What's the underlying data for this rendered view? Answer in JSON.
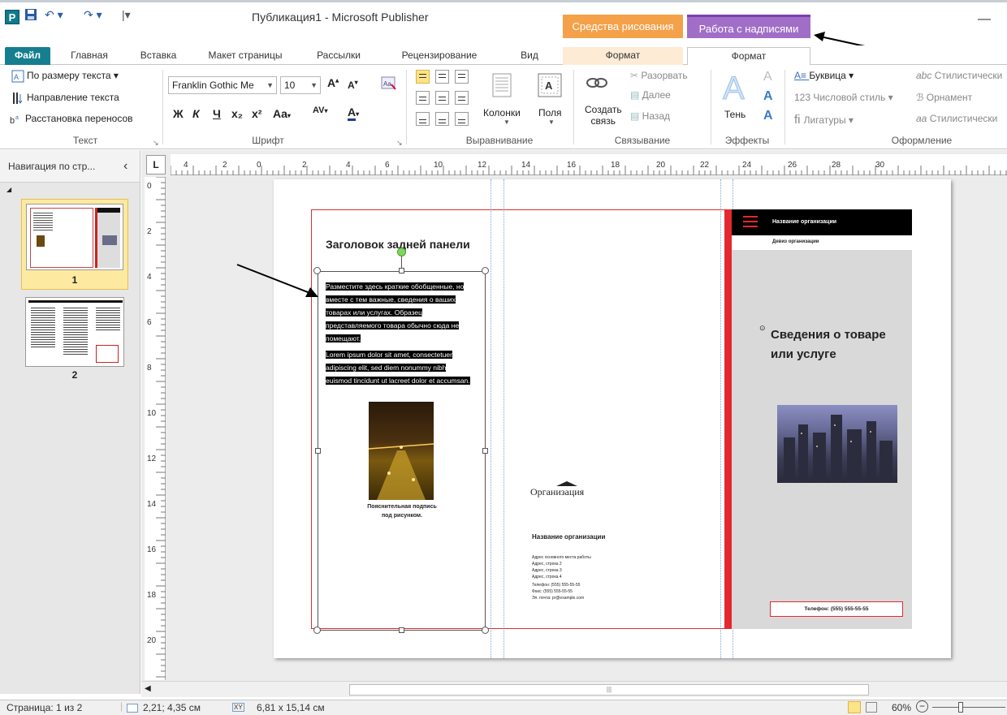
{
  "titlebar": {
    "window_title": "Публикация1 - Microsoft Publisher",
    "ctx_drawing": "Средства рисования",
    "ctx_text": "Работа с надписями",
    "minimize": "—"
  },
  "tabs": {
    "file": "Файл",
    "items": [
      "Главная",
      "Вставка",
      "Макет страницы",
      "Рассылки",
      "Рецензирование",
      "Вид"
    ],
    "ctx_format_draw": "Формат",
    "ctx_format_text": "Формат"
  },
  "ribbon": {
    "text_group": {
      "fit": "По размеру текста ▾",
      "direction": "Направление текста",
      "hyphen": "Расстановка переносов",
      "label": "Текст"
    },
    "font_group": {
      "font_name": "Franklin Gothic Me",
      "font_size": "10",
      "label": "Шрифт",
      "bold": "Ж",
      "italic": "К",
      "underline": "Ч",
      "sub": "x₂",
      "sup": "x²",
      "case": "Aa",
      "spacing": "AV",
      "color": "A"
    },
    "align_group": {
      "columns": "Колонки",
      "margins": "Поля",
      "label": "Выравнивание"
    },
    "link_group": {
      "create_line1": "Создать",
      "create_line2": "связь",
      "break": "Разорвать",
      "next": "Далее",
      "back": "Назад",
      "label": "Связывание"
    },
    "effects_group": {
      "shadow": "Тень",
      "label": "Эффекты"
    },
    "typo_group": {
      "dropcap": "Буквица ▾",
      "numstyle": "Числовой стиль ▾",
      "ligatures": "Лигатуры ▾",
      "stylistic1": "Стилистически",
      "ornament": "Орнамент",
      "stylistic2": "Стилистически",
      "label": "Оформление"
    }
  },
  "navpane": {
    "title": "Навигация по стр...",
    "collapse": "‹",
    "page1": "1",
    "page2": "2"
  },
  "rulers": {
    "h_ticks": [
      "4",
      "2",
      "0",
      "2",
      "4",
      "6",
      "10",
      "12",
      "14",
      "16",
      "18",
      "20",
      "22",
      "24",
      "26",
      "28",
      "30"
    ],
    "v_ticks": [
      "0",
      "2",
      "4",
      "6",
      "8",
      "10",
      "12",
      "14",
      "16",
      "18",
      "20"
    ],
    "corner": "L"
  },
  "document": {
    "panel1_heading": "Заголовок задней панели",
    "panel1_para1": "Разместите здесь краткие обобщенные, но вместе с тем важные, сведения о ваших товарах или услугах. Образец представляемого товара обычно сюда не помещают.",
    "panel1_para2": "Lorem ipsum dolor sit amet, consectetuer adipiscing elit, sed diem nonummy nibh euismod tincidunt ut lacreet dolor et accumsan.",
    "panel1_caption": "Пояснительная подпись под рисунком.",
    "panel2_logo": "Организация",
    "panel2_org": "Название организации",
    "panel2_addr": [
      "Адрес основного места работы",
      "Адрес, строка 2",
      "Адрес, строка 3",
      "Адрес, строка 4"
    ],
    "panel2_phone": "Телефон: (555) 555-55-55",
    "panel2_fax": "Факс: (555) 555-55-55",
    "panel2_email": "Эл. почта: pr@example.com",
    "panel3_org": "Название организации",
    "panel3_motto": "Девиз организации",
    "panel3_title": "Сведения о товаре или услуге",
    "panel3_phone": "Телефон: (555) 555-55-55"
  },
  "status": {
    "page": "Страница: 1 из 2",
    "position": "2,21; 4,35 см",
    "size": "6,81 x 15,14 см",
    "zoom": "60%"
  }
}
